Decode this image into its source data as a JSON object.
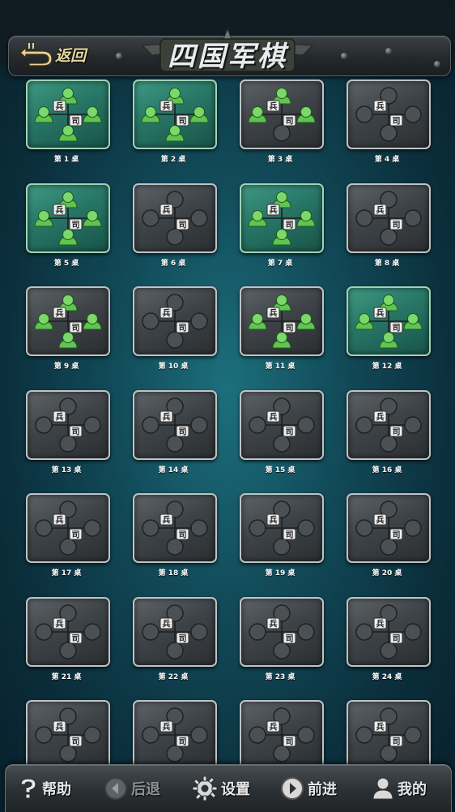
{
  "header": {
    "back_label": "返回",
    "title": "四国军棋"
  },
  "table_icons": {
    "soldier_label": "兵",
    "commander_label": "司"
  },
  "tables": [
    {
      "label": "第 1 桌",
      "occupied": true,
      "seats": 4
    },
    {
      "label": "第 2 桌",
      "occupied": true,
      "seats": 4
    },
    {
      "label": "第 3 桌",
      "occupied": false,
      "seats": 3
    },
    {
      "label": "第 4 桌",
      "occupied": false,
      "seats": 0
    },
    {
      "label": "第 5 桌",
      "occupied": true,
      "seats": 4
    },
    {
      "label": "第 6 桌",
      "occupied": false,
      "seats": 0
    },
    {
      "label": "第 7 桌",
      "occupied": true,
      "seats": 4
    },
    {
      "label": "第 8 桌",
      "occupied": false,
      "seats": 0
    },
    {
      "label": "第 9 桌",
      "occupied": false,
      "seats": 4
    },
    {
      "label": "第 10 桌",
      "occupied": false,
      "seats": 0
    },
    {
      "label": "第 11 桌",
      "occupied": false,
      "seats": 4
    },
    {
      "label": "第 12 桌",
      "occupied": true,
      "seats": 4
    },
    {
      "label": "第 13 桌",
      "occupied": false,
      "seats": 0
    },
    {
      "label": "第 14 桌",
      "occupied": false,
      "seats": 0
    },
    {
      "label": "第 15 桌",
      "occupied": false,
      "seats": 0
    },
    {
      "label": "第 16 桌",
      "occupied": false,
      "seats": 0
    },
    {
      "label": "第 17 桌",
      "occupied": false,
      "seats": 0
    },
    {
      "label": "第 18 桌",
      "occupied": false,
      "seats": 0
    },
    {
      "label": "第 19 桌",
      "occupied": false,
      "seats": 0
    },
    {
      "label": "第 20 桌",
      "occupied": false,
      "seats": 0
    },
    {
      "label": "第 21 桌",
      "occupied": false,
      "seats": 0
    },
    {
      "label": "第 22 桌",
      "occupied": false,
      "seats": 0
    },
    {
      "label": "第 23 桌",
      "occupied": false,
      "seats": 0
    },
    {
      "label": "第 24 桌",
      "occupied": false,
      "seats": 0
    },
    {
      "label": "",
      "occupied": false,
      "seats": 0
    },
    {
      "label": "",
      "occupied": false,
      "seats": 0
    },
    {
      "label": "",
      "occupied": false,
      "seats": 0
    },
    {
      "label": "",
      "occupied": false,
      "seats": 0
    }
  ],
  "bottom_nav": [
    {
      "label": "帮助",
      "icon": "question-icon",
      "enabled": true
    },
    {
      "label": "后退",
      "icon": "back-arrow-icon",
      "enabled": false
    },
    {
      "label": "设置",
      "icon": "gear-icon",
      "enabled": true
    },
    {
      "label": "前进",
      "icon": "forward-arrow-icon",
      "enabled": true
    },
    {
      "label": "我的",
      "icon": "user-icon",
      "enabled": true
    }
  ],
  "colors": {
    "occupied_table": "#277566",
    "empty_table": "#3e4347",
    "player_green": "#5fc451",
    "header_text": "#e8d7a0"
  }
}
